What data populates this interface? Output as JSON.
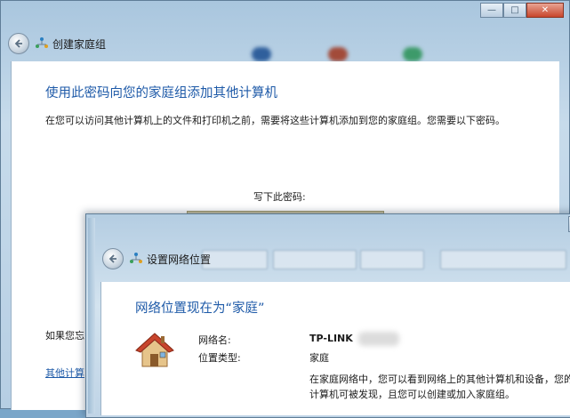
{
  "window1": {
    "nav_title": "创建家庭组",
    "heading": "使用此密码向您的家庭组添加其他计算机",
    "description": "在您可以访问其他计算机上的文件和打印机之前，需要将这些计算机添加到您的家庭组。您需要以下密码。",
    "password_label": "写下此密码:",
    "cut_text": "如果您忘",
    "cut_link": "其他计算",
    "caption": {
      "minimize": "—",
      "maximize": "□",
      "close": "✕"
    }
  },
  "window2": {
    "nav_title": "设置网络位置",
    "heading": "网络位置现在为“家庭”",
    "network_name_label": "网络名:",
    "network_name_value": "TP-LINK",
    "location_type_label": "位置类型:",
    "location_type_value": "家庭",
    "description": "在家庭网络中，您可以看到网络上的其他计算机和设备，您的计算机可被发现，且您可以创建或加入家庭组。"
  },
  "icons": {
    "back": "back-arrow-icon",
    "homegroup": "homegroup-icon",
    "house": "house-icon"
  },
  "colors": {
    "heading_blue": "#1e5aa8",
    "close_red": "#c8452c"
  }
}
